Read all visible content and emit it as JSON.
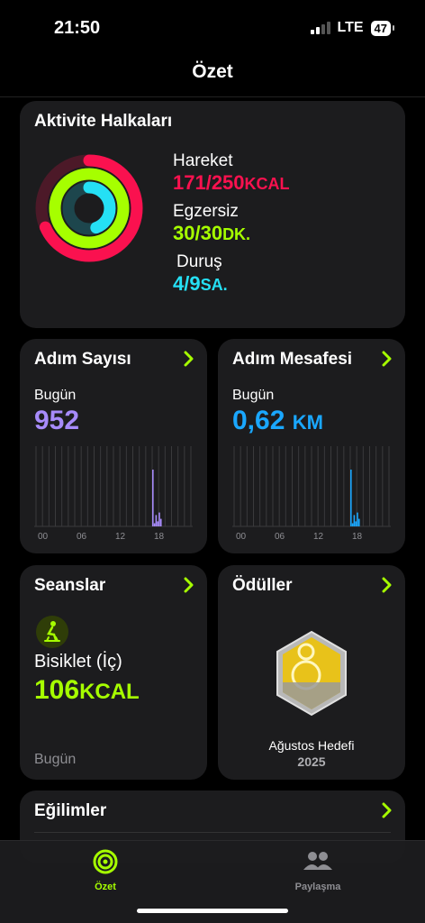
{
  "status": {
    "time": "21:50",
    "network": "LTE",
    "battery": "47"
  },
  "nav": {
    "title": "Özet"
  },
  "activity": {
    "title": "Aktivite Halkaları",
    "move": {
      "label": "Hareket",
      "value": "171/250",
      "unit": "KCAL",
      "progress": 0.684,
      "color": "#fa114f"
    },
    "exercise": {
      "label": "Egzersiz",
      "value": "30/30",
      "unit": "DK.",
      "progress": 1.0,
      "color": "#a6ff00"
    },
    "stand": {
      "label": "Duruş",
      "value": "4/9",
      "unit": "SA.",
      "progress": 0.444,
      "color": "#25e0f5"
    }
  },
  "steps": {
    "title": "Adım Sayısı",
    "sub": "Bugün",
    "value": "952",
    "color": "#a78bfa",
    "ticks": [
      "00",
      "06",
      "12",
      "18"
    ],
    "bars": [
      0,
      0,
      0,
      0,
      0,
      0,
      0,
      0,
      0,
      0,
      0,
      0,
      0,
      0,
      0,
      0,
      0,
      0,
      0,
      0,
      0,
      0,
      0,
      0,
      0,
      0,
      0,
      0,
      0,
      0,
      0,
      0,
      0,
      0,
      0,
      0,
      0,
      0,
      0,
      0,
      0,
      0,
      0,
      0,
      0,
      0,
      0,
      0,
      0,
      0,
      0,
      0,
      0,
      0,
      0,
      0,
      0,
      0,
      0,
      0,
      0,
      0,
      0,
      0,
      0,
      0,
      0,
      0,
      0,
      0,
      0,
      0,
      0.9,
      0.05,
      0.18,
      0.08,
      0.22,
      0.12,
      0,
      0,
      0,
      0,
      0,
      0,
      0,
      0,
      0,
      0,
      0,
      0,
      0,
      0,
      0,
      0,
      0,
      0
    ]
  },
  "distance": {
    "title": "Adım Mesafesi",
    "sub": "Bugün",
    "value": "0,62",
    "unit": "KM",
    "color": "#1aa7ff",
    "ticks": [
      "00",
      "06",
      "12",
      "18"
    ],
    "bars": [
      0,
      0,
      0,
      0,
      0,
      0,
      0,
      0,
      0,
      0,
      0,
      0,
      0,
      0,
      0,
      0,
      0,
      0,
      0,
      0,
      0,
      0,
      0,
      0,
      0,
      0,
      0,
      0,
      0,
      0,
      0,
      0,
      0,
      0,
      0,
      0,
      0,
      0,
      0,
      0,
      0,
      0,
      0,
      0,
      0,
      0,
      0,
      0,
      0,
      0,
      0,
      0,
      0,
      0,
      0,
      0,
      0,
      0,
      0,
      0,
      0,
      0,
      0,
      0,
      0,
      0,
      0,
      0,
      0,
      0,
      0,
      0,
      0.9,
      0.05,
      0.18,
      0.08,
      0.22,
      0.12,
      0,
      0,
      0,
      0,
      0,
      0,
      0,
      0,
      0,
      0,
      0,
      0,
      0,
      0,
      0,
      0,
      0,
      0
    ]
  },
  "sessions": {
    "title": "Seanslar",
    "workout": "Bisiklet (İç)",
    "value": "106",
    "unit": "KCAL",
    "date": "Bugün",
    "icon": "indoor-cycle-icon"
  },
  "awards": {
    "title": "Ödüller",
    "name": "Ağustos Hedefi",
    "year": "2025"
  },
  "trends": {
    "title": "Eğilimler"
  },
  "tabs": [
    {
      "label": "Özet",
      "icon": "activity-rings-icon",
      "active": true
    },
    {
      "label": "Paylaşma",
      "icon": "people-icon",
      "active": false
    }
  ]
}
